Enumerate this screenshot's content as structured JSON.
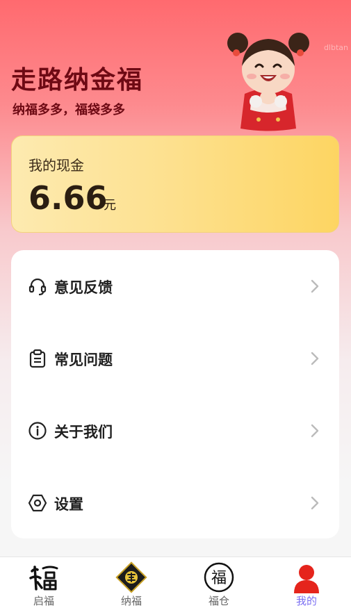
{
  "header": {
    "title": "走路纳金福",
    "subtitle": "纳福多多，福袋多多",
    "watermark": "dlbtan"
  },
  "cash_card": {
    "label": "我的现金",
    "amount": "6.66",
    "unit": "元"
  },
  "menu": {
    "items": [
      {
        "label": "意见反馈",
        "icon": "headset-icon"
      },
      {
        "label": "常见问题",
        "icon": "clipboard-icon"
      },
      {
        "label": "关于我们",
        "icon": "info-icon"
      },
      {
        "label": "设置",
        "icon": "settings-hex-icon"
      }
    ]
  },
  "tabbar": {
    "active_color": "#7b6ff2",
    "tabs": [
      {
        "label": "启福",
        "icon": "fu-calligraphy-icon"
      },
      {
        "label": "纳福",
        "icon": "fu-diamond-icon"
      },
      {
        "label": "福仓",
        "icon": "fu-circle-icon",
        "icon_text": "福"
      },
      {
        "label": "我的",
        "icon": "user-icon",
        "active": true
      }
    ]
  }
}
